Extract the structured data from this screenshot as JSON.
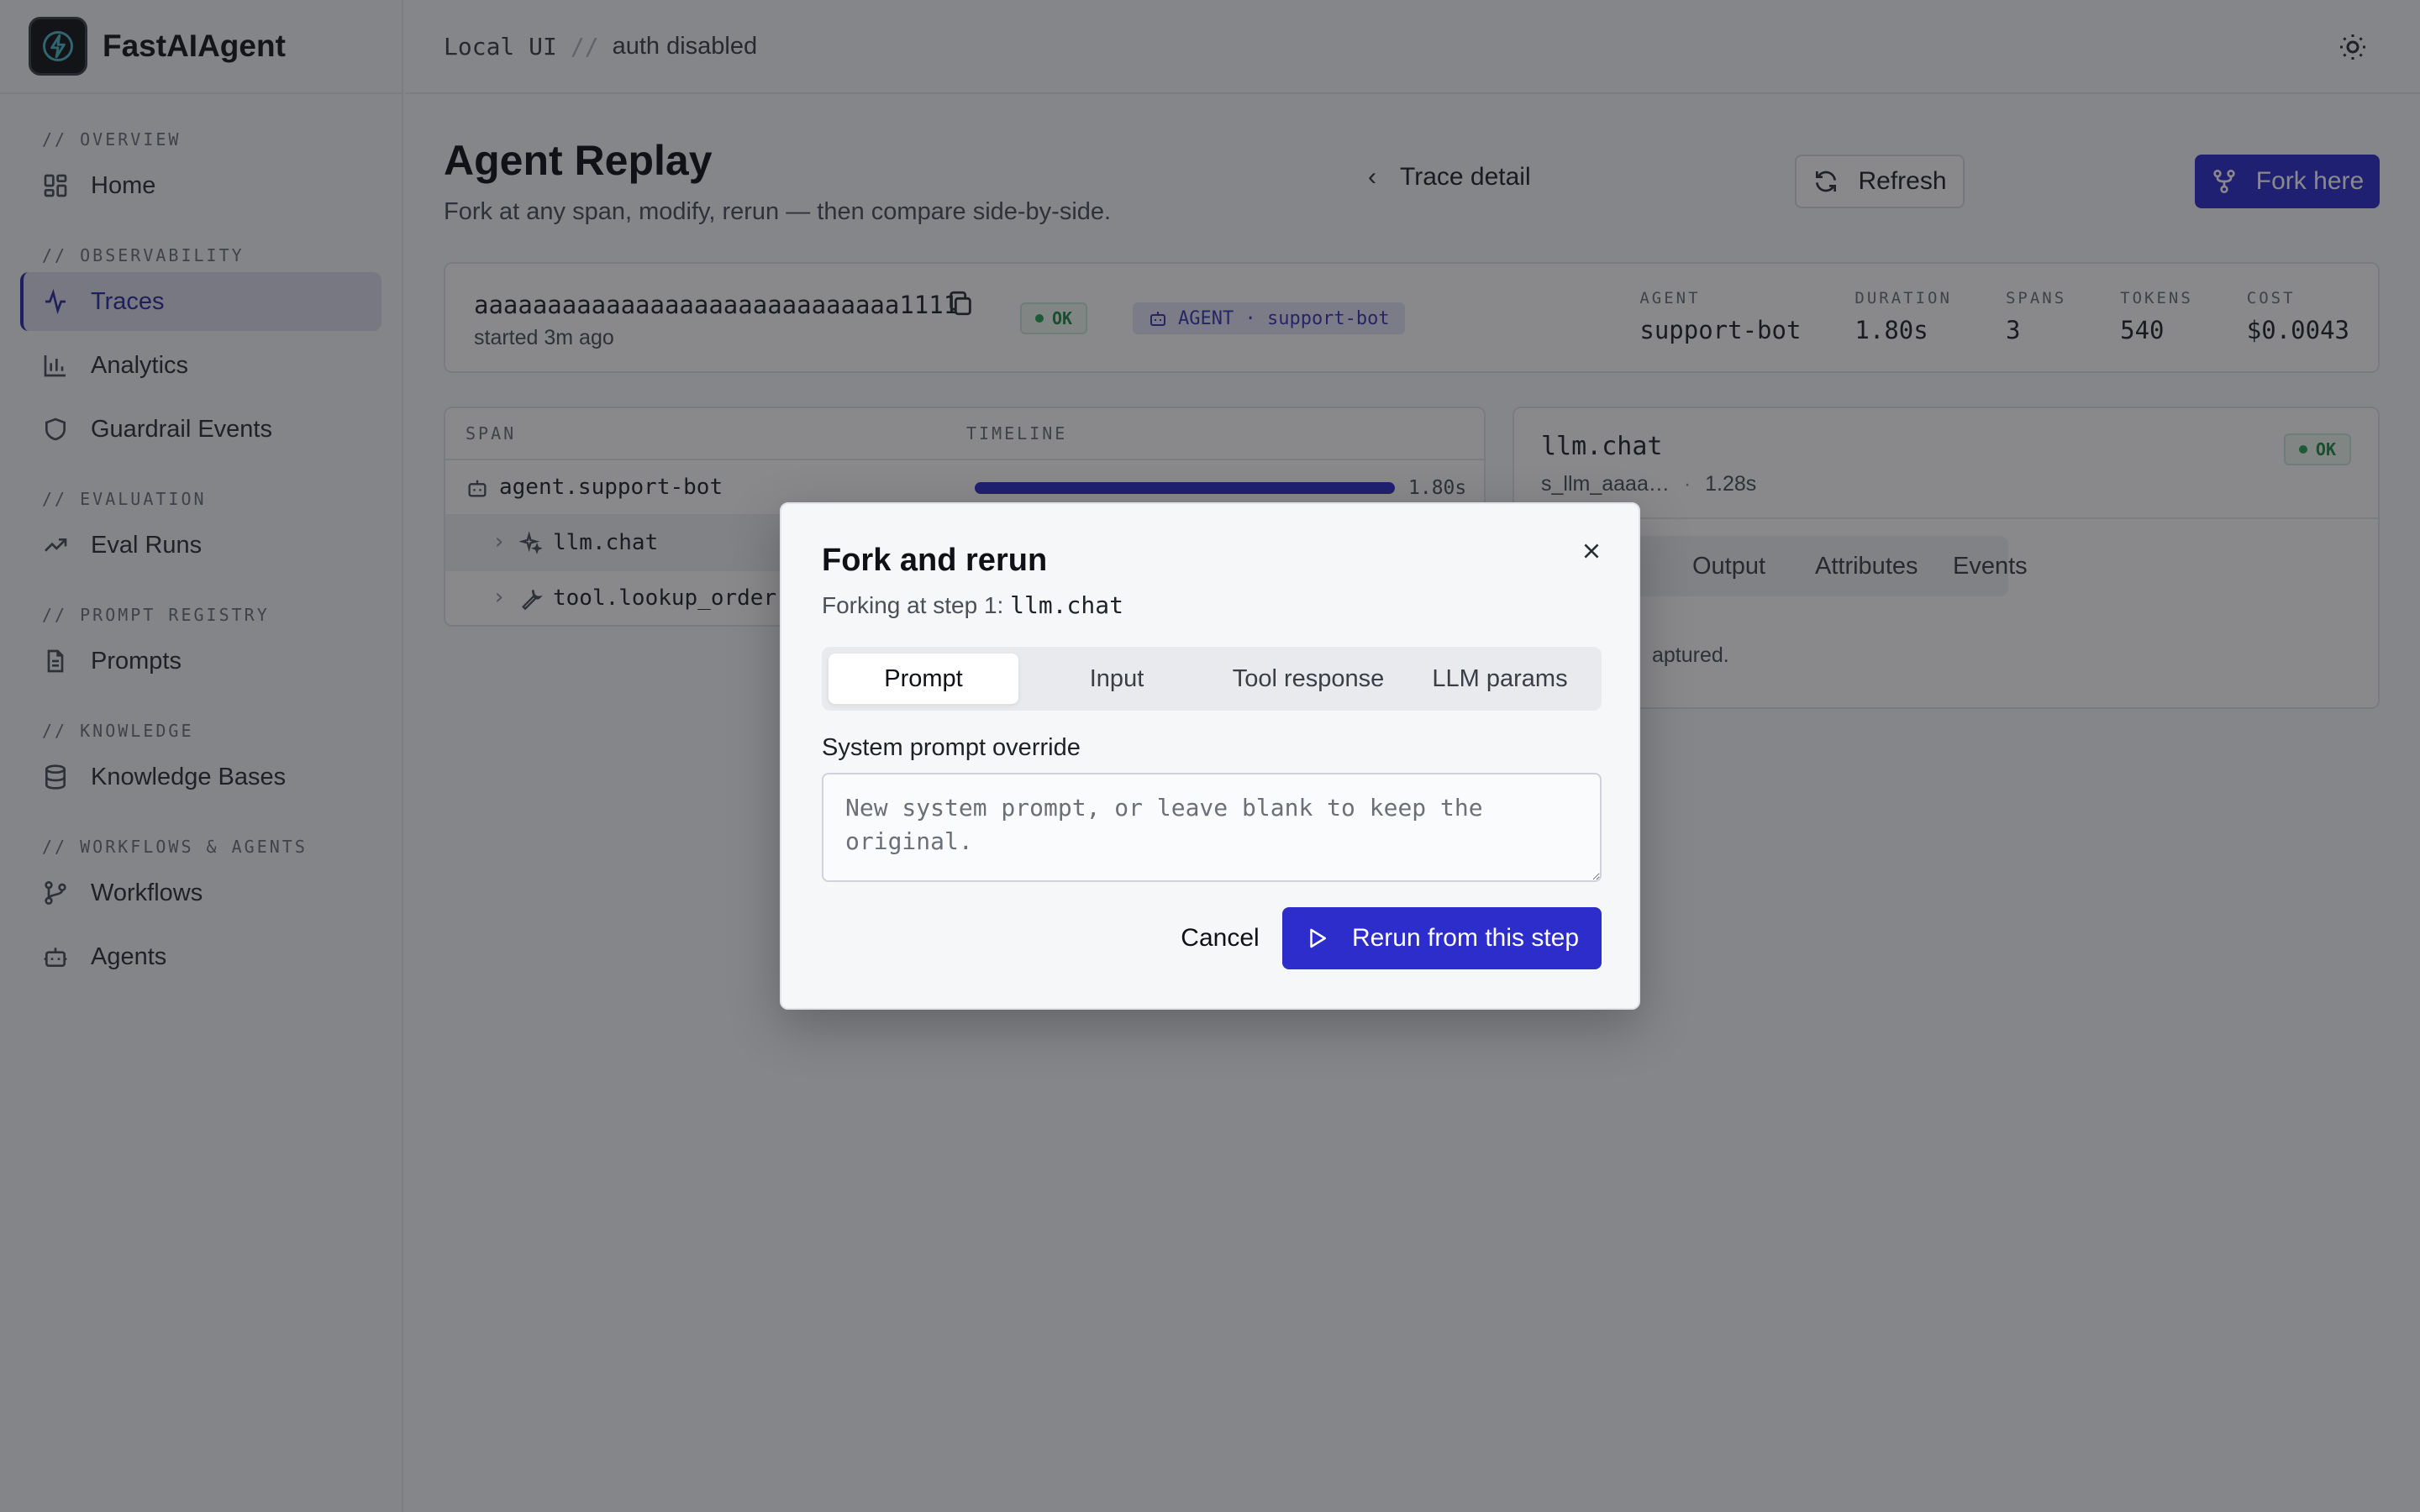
{
  "app": {
    "name": "FastAIAgent"
  },
  "topbar": {
    "env": "Local UI",
    "separator": "//",
    "auth": "auth disabled"
  },
  "sidebar": {
    "sections": [
      {
        "title": "// OVERVIEW",
        "items": [
          {
            "label": "Home",
            "icon": "grid-icon"
          }
        ]
      },
      {
        "title": "// OBSERVABILITY",
        "items": [
          {
            "label": "Traces",
            "icon": "activity-icon",
            "active": true
          },
          {
            "label": "Analytics",
            "icon": "bar-chart-icon"
          },
          {
            "label": "Guardrail Events",
            "icon": "shield-icon"
          }
        ]
      },
      {
        "title": "// EVALUATION",
        "items": [
          {
            "label": "Eval Runs",
            "icon": "trending-up-icon"
          }
        ]
      },
      {
        "title": "// PROMPT REGISTRY",
        "items": [
          {
            "label": "Prompts",
            "icon": "file-text-icon"
          }
        ]
      },
      {
        "title": "// KNOWLEDGE",
        "items": [
          {
            "label": "Knowledge Bases",
            "icon": "database-icon"
          }
        ]
      },
      {
        "title": "// WORKFLOWS & AGENTS",
        "items": [
          {
            "label": "Workflows",
            "icon": "git-branch-icon"
          },
          {
            "label": "Agents",
            "icon": "bot-icon"
          }
        ]
      }
    ]
  },
  "page": {
    "title": "Agent Replay",
    "subtitle": "Fork at any span, modify, rerun — then compare side-by-side.",
    "back_label": "Trace detail",
    "refresh_label": "Refresh",
    "fork_label": "Fork here"
  },
  "summary": {
    "trace_id": "aaaaaaaaaaaaaaaaaaaaaaaaaaaaa1111",
    "started": "started 3m ago",
    "status": "OK",
    "agent_badge": "AGENT · support-bot",
    "stats": [
      {
        "label": "AGENT",
        "value": "support-bot"
      },
      {
        "label": "DURATION",
        "value": "1.80s"
      },
      {
        "label": "SPANS",
        "value": "3"
      },
      {
        "label": "TOKENS",
        "value": "540"
      },
      {
        "label": "COST",
        "value": "$0.0043"
      }
    ]
  },
  "spans": {
    "headers": {
      "span": "SPAN",
      "timeline": "TIMELINE"
    },
    "rows": [
      {
        "name": "agent.support-bot",
        "icon": "bot-icon",
        "duration": "1.80s",
        "fraction": 1.0
      },
      {
        "name": "llm.chat",
        "icon": "sparkles-icon"
      },
      {
        "name": "tool.lookup_order",
        "icon": "wrench-icon"
      }
    ]
  },
  "detail": {
    "name": "llm.chat",
    "span_id": "s_llm_aaaa…",
    "dot": "·",
    "duration": "1.28s",
    "status": "OK",
    "tabs": [
      "Output",
      "Attributes",
      "Events"
    ],
    "empty_text": "aptured."
  },
  "modal": {
    "title": "Fork and rerun",
    "subtitle_prefix": "Forking at step 1: ",
    "subtitle_code": "llm.chat",
    "tabs": [
      "Prompt",
      "Input",
      "Tool response",
      "LLM params"
    ],
    "active_tab": "Prompt",
    "field_label": "System prompt override",
    "placeholder": "New system prompt, or leave blank to keep the original.",
    "cancel_label": "Cancel",
    "submit_label": "Rerun from this step"
  },
  "colors": {
    "accent": "#2d2dcc",
    "ok": "#22a355",
    "overlay": "rgba(20,20,24,0.5)"
  }
}
